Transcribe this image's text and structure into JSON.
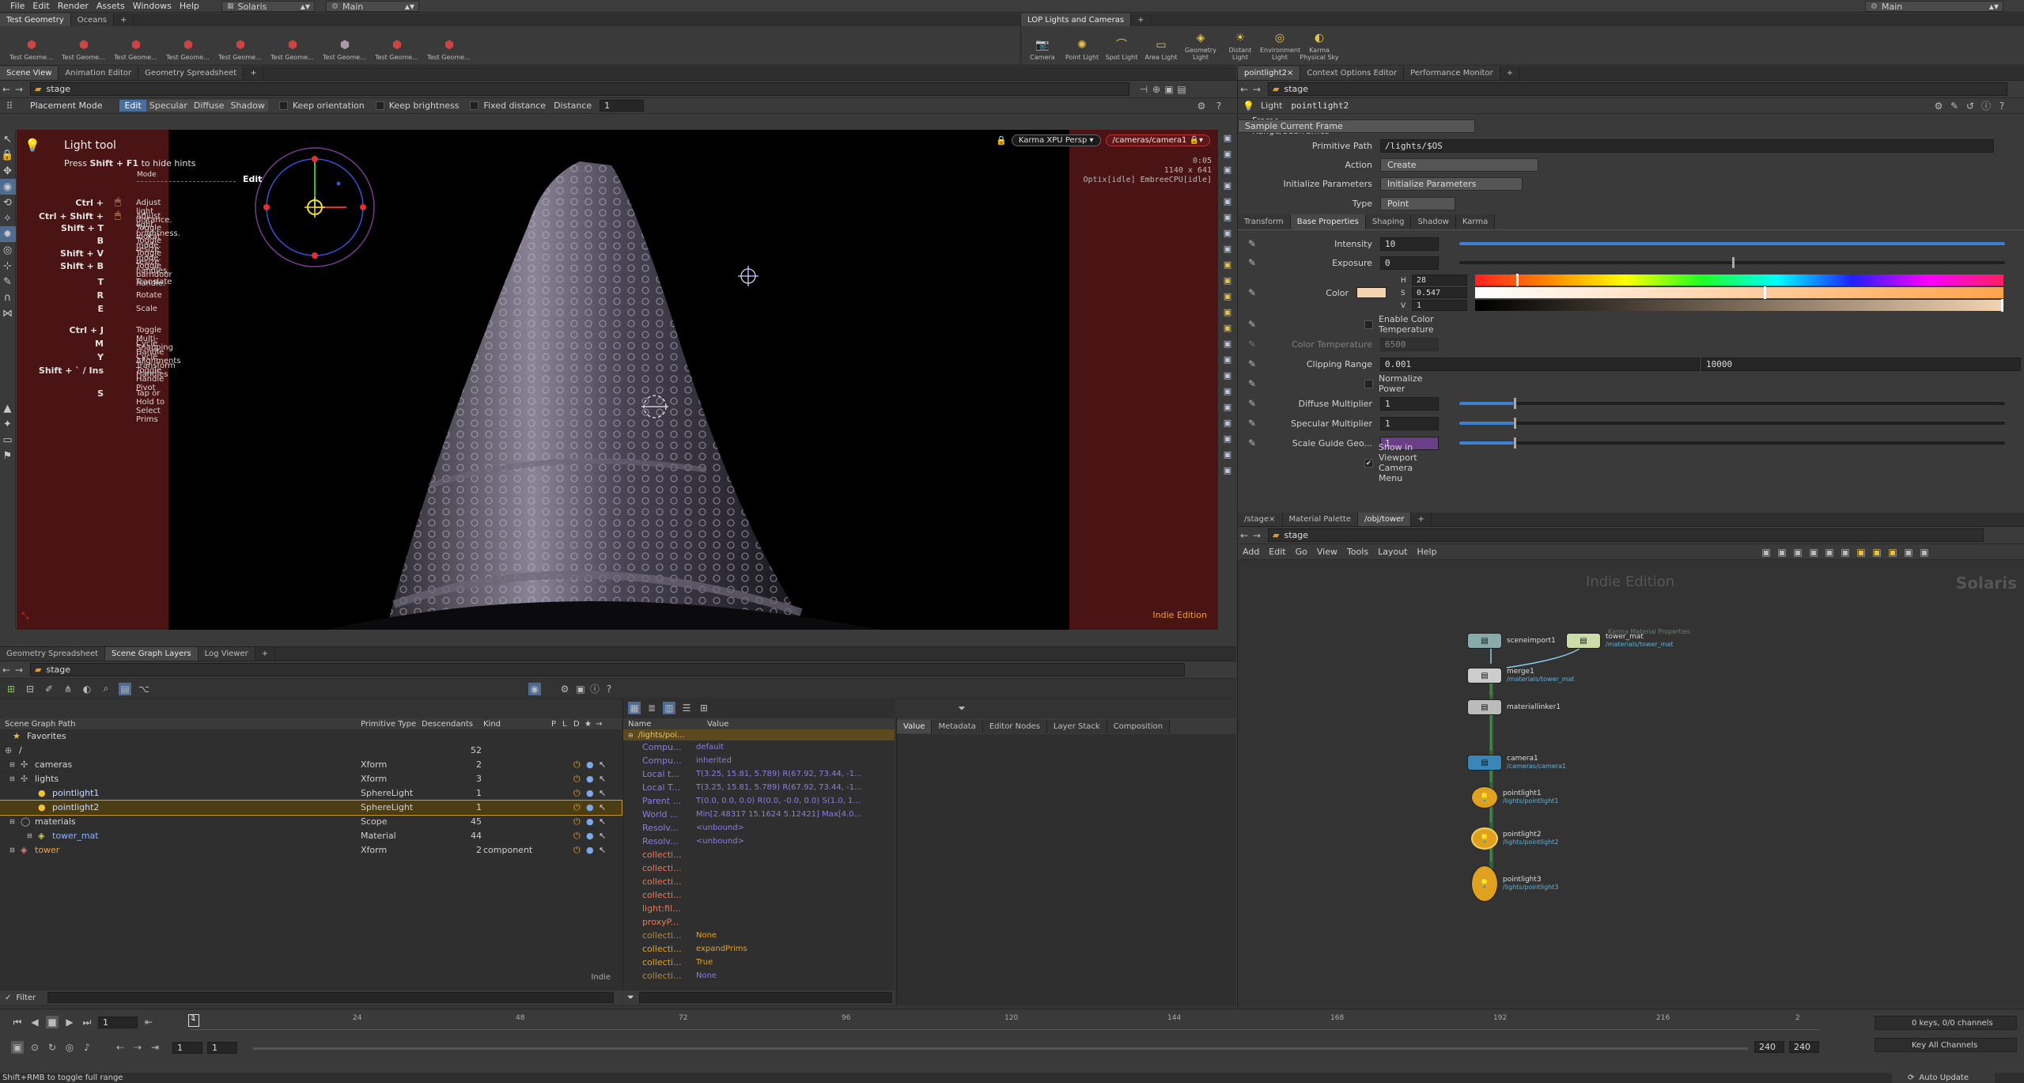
{
  "menubar": {
    "items": [
      "File",
      "Edit",
      "Render",
      "Assets",
      "Windows",
      "Help"
    ],
    "desktop": "Solaris",
    "context": "Main",
    "right_context": "Main"
  },
  "shelf_left": {
    "tabs": [
      "Test Geometry",
      "Oceans"
    ],
    "tools": [
      "Test Geometry: C...",
      "Test Geometry: P...",
      "Test Geometry: R...",
      "Test Geometry: S...",
      "Test Geometry: S...",
      "Test Geometry: T...",
      "Test Geometry: T...",
      "Test Geometry: T...",
      "Test Geometry: T..."
    ]
  },
  "shelf_right": {
    "tabs": [
      "LOP Lights and Cameras"
    ],
    "tools": [
      "Camera",
      "Point Light",
      "Spot Light",
      "Area Light",
      "Geometry Light",
      "Distant Light",
      "Environment Light",
      "Karma Physical Sky"
    ]
  },
  "viewer": {
    "tabs": [
      "Scene View",
      "Animation Editor",
      "Geometry Spreadsheet"
    ],
    "path": "stage",
    "toolbar": {
      "mode": "Placement Mode",
      "edit": "Edit",
      "specular": "Specular",
      "diffuse": "Diffuse",
      "shadow": "Shadow",
      "keep_orientation": "Keep orientation",
      "keep_brightness": "Keep brightness",
      "fixed_distance": "Fixed distance",
      "distance_label": "Distance",
      "distance_value": "1"
    },
    "renderer": "Karma XPU",
    "persp": "Persp",
    "camera": "/cameras/camera1",
    "stats": [
      "0:05",
      "1140 x 641",
      "Optix[idle] EmbreeCPU[idle]"
    ],
    "edition": "Indie Edition",
    "hints": {
      "title": "Light tool",
      "press_prefix": "Press ",
      "press_key": "Shift + F1",
      "press_suffix": " to hide hints",
      "mode_label": "Mode",
      "edit_label": "Edit",
      "items": [
        {
          "key": "Ctrl +",
          "text": "Adjust light distance."
        },
        {
          "key": "Ctrl + Shift +",
          "text": "Adjust light brightness."
        },
        {
          "key": "Shift + T",
          "text": "Toggle lookat mode."
        },
        {
          "key": "B",
          "text": "Toggle resize mode."
        },
        {
          "key": "Shift + V",
          "text": "Toggle resize handles."
        },
        {
          "key": "Shift + B",
          "text": "Toggle barndoor handle."
        },
        {
          "key": "T",
          "text": "Translate"
        },
        {
          "key": "R",
          "text": "Rotate"
        },
        {
          "key": "E",
          "text": "Scale"
        },
        {
          "key": "Ctrl + J",
          "text": "Toggle Multi-Snapping"
        },
        {
          "key": "M",
          "text": "Cycle Handle Alignments"
        },
        {
          "key": "Y",
          "text": "Cycle Transform Handles"
        },
        {
          "key": "Shift + ` / Ins",
          "text": "Toggle Handle Pivot"
        },
        {
          "key": "S",
          "text": "Tap or Hold to Select Prims"
        }
      ]
    }
  },
  "params": {
    "tabs": [
      "pointlight2",
      "Context Options Editor",
      "Performance Monitor"
    ],
    "path": "stage",
    "node_type": "Light",
    "node_name": "pointlight2",
    "frame_range_label": "Frame Range/Subframes",
    "frame_range_value": "Sample Current Frame",
    "prim_path_label": "Primitive Path",
    "prim_path_value": "/lights/$OS",
    "action_label": "Action",
    "action_value": "Create",
    "init_label": "Initialize Parameters",
    "init_value": "Initialize Parameters",
    "type_label": "Type",
    "type_value": "Point",
    "subtabs": [
      "Transform",
      "Base Properties",
      "Shaping",
      "Shadow",
      "Karma"
    ],
    "intensity_label": "Intensity",
    "intensity_value": "10",
    "intensity_level": 1.0,
    "exposure_label": "Exposure",
    "exposure_value": "0",
    "exposure_level": 0.5,
    "color_label": "Color",
    "color_swatch": "#f3d3b0",
    "h_label": "H",
    "h_value": "28",
    "s_label": "S",
    "s_value": "0.547",
    "v_label": "V",
    "v_value": "1",
    "h_level": 0.078,
    "s_level": 0.547,
    "v_level": 1.0,
    "enable_color_temp": "Enable Color Temperature",
    "color_temp_label": "Color Temperature",
    "color_temp_value": "6500",
    "clipping_label": "Clipping Range",
    "clip_min": "0.001",
    "clip_max": "10000",
    "normalize_label": "Normalize Power",
    "diffuse_label": "Diffuse Multiplier",
    "diffuse_value": "1",
    "diffuse_level": 0.1,
    "specular_label": "Specular Multiplier",
    "specular_value": "1",
    "specular_level": 0.1,
    "scale_label": "Scale Guide Geo...",
    "scale_value": "1",
    "scale_level": 0.1,
    "show_cam_menu": "Show in Viewport Camera Menu"
  },
  "network": {
    "tabs": [
      "/stage",
      "Material Palette",
      "/obj/tower"
    ],
    "path": "stage",
    "menu": [
      "Add",
      "Edit",
      "Go",
      "View",
      "Tools",
      "Layout",
      "Help"
    ],
    "watermark_left": "Indie Edition",
    "watermark_right": "Solaris",
    "nodes": [
      {
        "name": "sceneimport1",
        "sub": ""
      },
      {
        "name": "tower_mat",
        "sub": "/materials/tower_mat"
      },
      {
        "name": "merge1",
        "sub": "/materials/tower_mat"
      },
      {
        "name": "materiallinker1",
        "sub": ""
      },
      {
        "name": "camera1",
        "sub": "/cameras/camera1"
      },
      {
        "name": "pointlight1",
        "sub": "/lights/pointlight1"
      },
      {
        "name": "pointlight2",
        "sub": "/lights/pointlight2"
      },
      {
        "name": "pointlight3",
        "sub": "/lights/pointlight3"
      }
    ],
    "tower_mat_note": "Karma Material Properties"
  },
  "scenegraph": {
    "tabs": [
      "Geometry Spreadsheet",
      "Scene Graph Layers",
      "Log Viewer"
    ],
    "path": "stage",
    "columns": [
      "Scene Graph Path",
      "Primitive Type",
      "Descendants",
      "Kind",
      "P",
      "L",
      "D",
      "★",
      "→"
    ],
    "rows": [
      {
        "name": "Favorites",
        "type": "",
        "desc": "",
        "kind": ""
      },
      {
        "name": "/",
        "type": "",
        "desc": "52",
        "kind": ""
      },
      {
        "name": "cameras",
        "type": "Xform",
        "desc": "2",
        "kind": ""
      },
      {
        "name": "lights",
        "type": "Xform",
        "desc": "3",
        "kind": ""
      },
      {
        "name": "pointlight1",
        "type": "SphereLight",
        "desc": "1",
        "kind": ""
      },
      {
        "name": "pointlight2",
        "type": "SphereLight",
        "desc": "1",
        "kind": ""
      },
      {
        "name": "materials",
        "type": "Scope",
        "desc": "45",
        "kind": ""
      },
      {
        "name": "tower_mat",
        "type": "Material",
        "desc": "44",
        "kind": ""
      },
      {
        "name": "tower",
        "type": "Xform",
        "desc": "2",
        "kind": "component"
      }
    ],
    "edition": "Indie",
    "filter_label": "Filter"
  },
  "inspector": {
    "columns": [
      "Name",
      "Value"
    ],
    "path": "/lights/poi...",
    "rows": [
      {
        "name": "Compu...",
        "value": "default"
      },
      {
        "name": "Compu...",
        "value": "inherited"
      },
      {
        "name": "Local t...",
        "value": "T(3.25, 15.81, 5.789) R(67.92, 73.44, -1..."
      },
      {
        "name": "Local T...",
        "value": "T(3.25, 15.81, 5.789) R(67.92, 73.44, -1..."
      },
      {
        "name": "Parent ...",
        "value": "T(0.0, 0.0, 0.0) R(0.0, -0.0, 0.0) S(1.0, 1..."
      },
      {
        "name": "World ...",
        "value": "Min[2.48317 15.1624 5.12421] Max[4.0..."
      },
      {
        "name": "Resolv...",
        "value": "<unbound>"
      },
      {
        "name": "Resolv...",
        "value": "<unbound>"
      },
      {
        "name": "collecti...",
        "value": ""
      },
      {
        "name": "collecti...",
        "value": ""
      },
      {
        "name": "collecti...",
        "value": ""
      },
      {
        "name": "collecti...",
        "value": ""
      },
      {
        "name": "light:fil...",
        "value": ""
      },
      {
        "name": "proxyP...",
        "value": ""
      },
      {
        "name": "collecti...",
        "value": "None"
      },
      {
        "name": "collecti...",
        "value": "expandPrims"
      },
      {
        "name": "collecti...",
        "value": "True"
      },
      {
        "name": "collecti...",
        "value": "None"
      }
    ],
    "value_tabs": [
      "Value",
      "Metadata",
      "Editor Nodes",
      "Layer Stack",
      "Composition"
    ]
  },
  "timeline": {
    "frame": "1",
    "start": "1",
    "end": "240",
    "end2": "240",
    "ticks": [
      "1",
      "24",
      "48",
      "72",
      "96",
      "120",
      "144",
      "168",
      "192",
      "216",
      "2"
    ],
    "keys": "0 keys, 0/0 channels",
    "key_all": "Key All Channels",
    "auto_update": "Auto Update",
    "status": "Shift+RMB to toggle full range"
  }
}
